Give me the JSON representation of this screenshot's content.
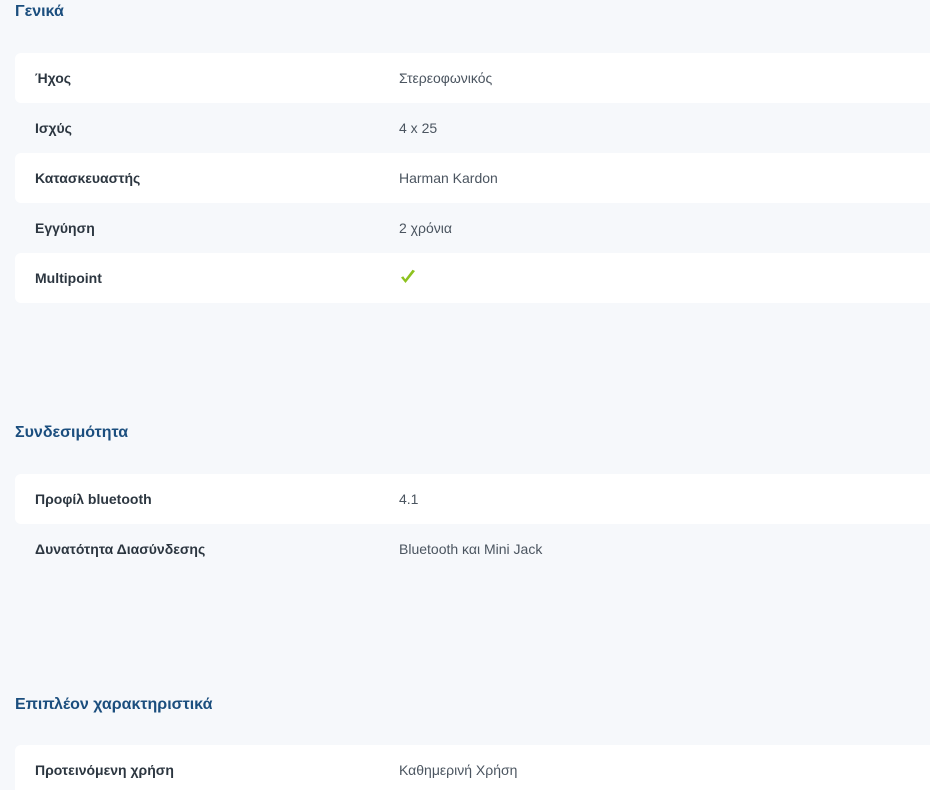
{
  "sections": [
    {
      "title": "Γενικά",
      "rows": [
        {
          "label": "Ήχος",
          "value": "Στερεοφωνικός"
        },
        {
          "label": "Ισχύς",
          "value": "4 x 25"
        },
        {
          "label": "Κατασκευαστής",
          "value": "Harman Kardon"
        },
        {
          "label": "Εγγύηση",
          "value": "2 χρόνια"
        },
        {
          "label": "Multipoint",
          "value": "",
          "icon": "checkmark-icon",
          "icon_color": "#8dc21f"
        }
      ]
    },
    {
      "title": "Συνδεσιμότητα",
      "rows": [
        {
          "label": "Προφίλ bluetooth",
          "value": "4.1"
        },
        {
          "label": "Δυνατότητα Διασύνδεσης",
          "value": "Bluetooth και Mini Jack"
        }
      ]
    },
    {
      "title": "Επιπλέον χαρακτηριστικά",
      "rows": [
        {
          "label": "Προτεινόμενη χρήση",
          "value": "Καθημερινή Χρήση"
        }
      ]
    }
  ],
  "colors": {
    "page_background": "#f6f8fb",
    "row_background": "#ffffff",
    "section_title": "#1b4e7e",
    "check": "#8dc21f"
  }
}
